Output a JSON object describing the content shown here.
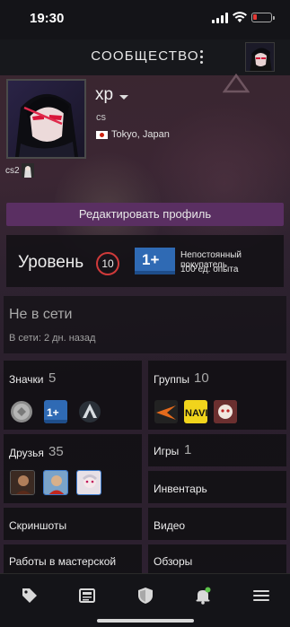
{
  "status_bar": {
    "time": "19:30"
  },
  "header": {
    "title": "СООБЩЕСТВО"
  },
  "profile": {
    "username": "xp",
    "real_name": "cs",
    "location": "Tokyo, Japan",
    "showcase_tag": "cs2",
    "edit_button": "Редактировать профиль"
  },
  "level": {
    "label": "Уровень",
    "value": "10",
    "badge_text": "1+",
    "badge_name": "Непостоянный покупатель",
    "badge_xp": "100 ед. опыта"
  },
  "status": {
    "main": "Не в сети",
    "sub": "В сети: 2 дн. назад"
  },
  "sections": {
    "badges": {
      "label": "Значки",
      "count": "5"
    },
    "groups": {
      "label": "Группы",
      "count": "10"
    },
    "friends": {
      "label": "Друзья",
      "count": "35"
    },
    "games": {
      "label": "Игры",
      "count": "1"
    },
    "inventory": {
      "label": "Инвентарь"
    },
    "screenshots": {
      "label": "Скриншоты"
    },
    "videos": {
      "label": "Видео"
    },
    "workshop": {
      "label": "Работы в мастерской"
    },
    "reviews": {
      "label": "Обзоры"
    }
  },
  "colors": {
    "accent_purple": "#5a2f62",
    "level_ring": "#cf3a3a",
    "badge_blue": "#2f6ab4",
    "notification_dot": "#5cc24a"
  },
  "nav": {
    "items": [
      "tag-icon",
      "news-icon",
      "shield-icon",
      "bell-icon",
      "menu-icon"
    ]
  }
}
